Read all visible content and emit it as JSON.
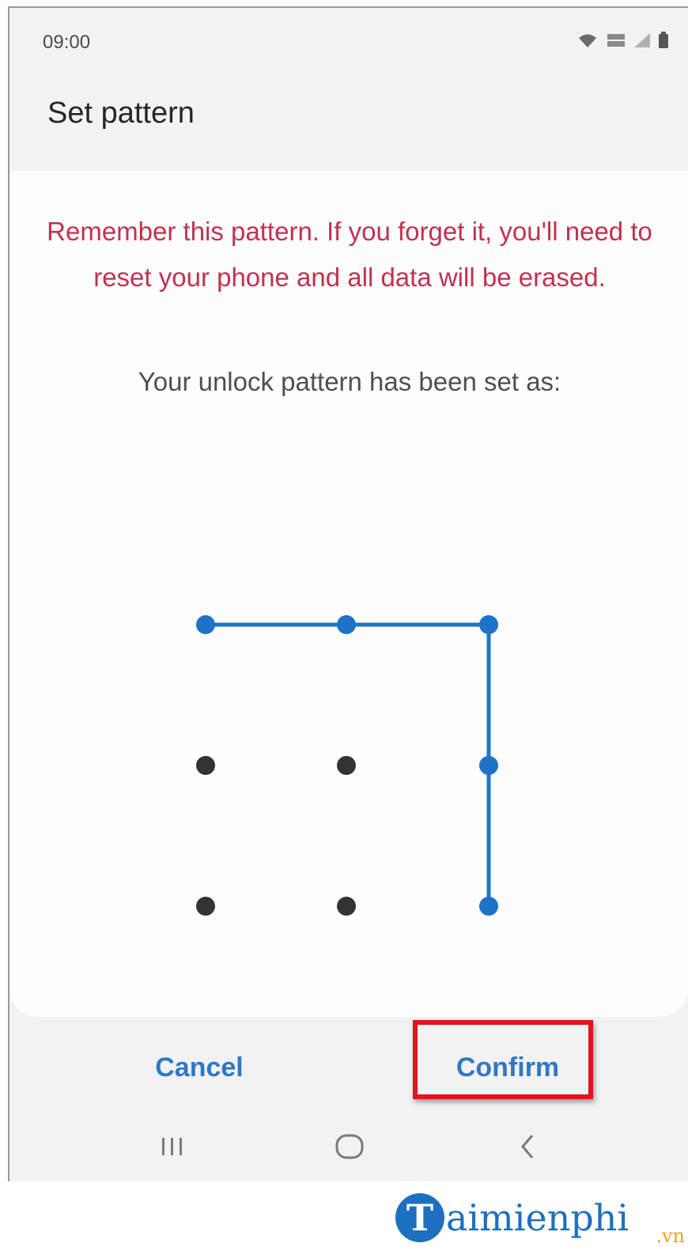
{
  "status_bar": {
    "time": "09:00",
    "icons": [
      "wifi-icon",
      "volte-lte-icon",
      "signal-icon",
      "battery-icon"
    ]
  },
  "app": {
    "title": "Set pattern"
  },
  "content": {
    "warning": "Remember this pattern. If you forget it, you'll need to reset your phone and all data will be erased.",
    "subtext": "Your unlock pattern has been set as:",
    "pattern": {
      "grid": 3,
      "selected_color": "#1e73c9",
      "unselected_color": "#333333",
      "path": [
        [
          0,
          0
        ],
        [
          0,
          1
        ],
        [
          0,
          2
        ],
        [
          1,
          2
        ],
        [
          2,
          2
        ]
      ]
    }
  },
  "actions": {
    "cancel_label": "Cancel",
    "confirm_label": "Confirm",
    "highlight_color": "#e2141c"
  },
  "nav_bar": {
    "icons": [
      "recents-icon",
      "home-icon",
      "back-icon"
    ]
  },
  "watermark": {
    "logo_letter": "T",
    "text": "aimienphi",
    "suffix": ".vn"
  }
}
